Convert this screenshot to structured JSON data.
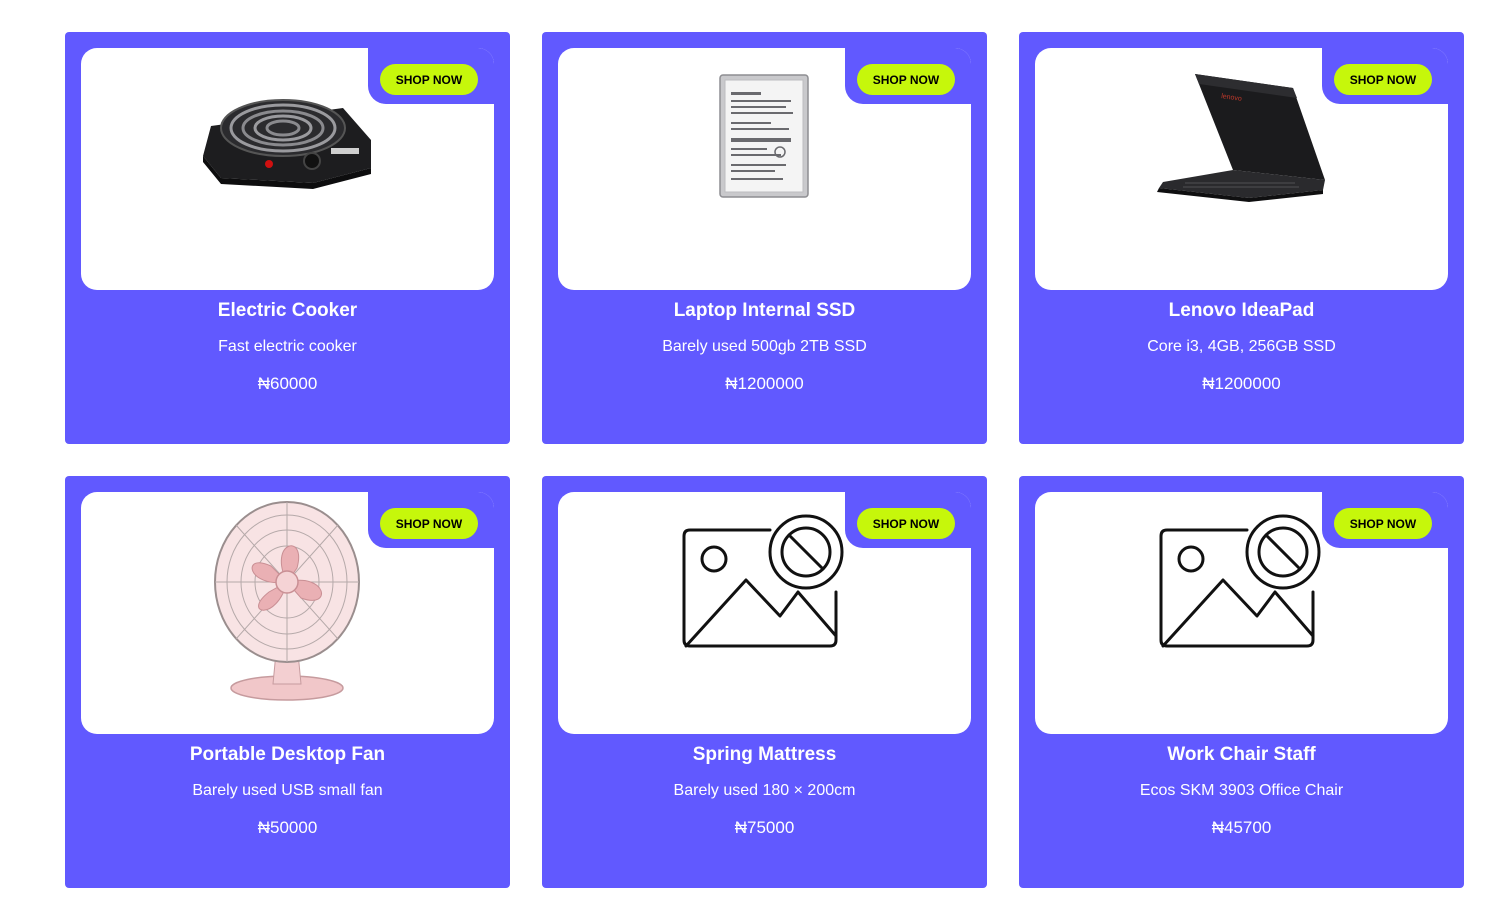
{
  "products": [
    {
      "title": "Electric Cooker",
      "description": "Fast electric cooker",
      "price": "₦60000",
      "button_label": "SHOP NOW",
      "image": "electric-cooker-image"
    },
    {
      "title": "Laptop Internal SSD",
      "description": "Barely used 500gb 2TB SSD",
      "price": "₦1200000",
      "button_label": "SHOP NOW",
      "image": "hard-drive-image"
    },
    {
      "title": "Lenovo IdeaPad",
      "description": "Core i3, 4GB, 256GB SSD",
      "price": "₦1200000",
      "button_label": "SHOP NOW",
      "image": "laptop-image",
      "image_brand_text": "lenovo"
    },
    {
      "title": "Portable Desktop Fan",
      "description": "Barely used USB small fan",
      "price": "₦50000",
      "button_label": "SHOP NOW",
      "image": "desk-fan-image"
    },
    {
      "title": "Spring Mattress",
      "description": "Barely used 180 × 200cm",
      "price": "₦75000",
      "button_label": "SHOP NOW",
      "image": "image-unavailable-icon"
    },
    {
      "title": "Work Chair Staff",
      "description": "Ecos SKM 3903 Office Chair",
      "price": "₦45700",
      "button_label": "SHOP NOW",
      "image": "image-unavailable-icon"
    }
  ],
  "colors": {
    "card_background": "#6159ff",
    "button_background": "#c6f70b",
    "button_text": "#000000",
    "card_text": "#ffffff"
  }
}
